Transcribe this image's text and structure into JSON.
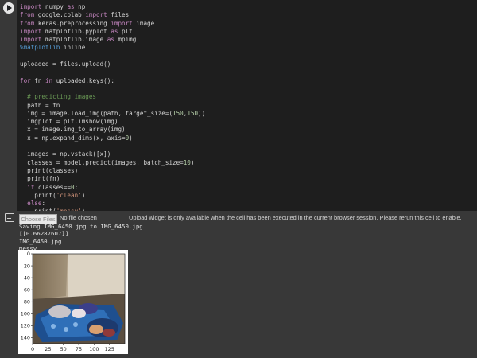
{
  "code": {
    "lines": [
      "import numpy as np",
      "from google.colab import files",
      "from keras.preprocessing import image",
      "import matplotlib.pyplot as plt",
      "import matplotlib.image as mpimg",
      "%matplotlib inline",
      "",
      "uploaded = files.upload()",
      "",
      "for fn in uploaded.keys():",
      "",
      "  # predicting images",
      "  path = fn",
      "  img = image.load_img(path, target_size=(150,150))",
      "  imgplot = plt.imshow(img)",
      "  x = image.img_to_array(img)",
      "  x = np.expand_dims(x, axis=0)",
      "",
      "  images = np.vstack([x])",
      "  classes = model.predict(images, batch_size=10)",
      "  print(classes)",
      "  print(fn)",
      "  if classes==0:",
      "    print('clean')",
      "  else:",
      "    print('messy')"
    ]
  },
  "upload_widget": {
    "button_label": "Choose Files",
    "file_status": "No file chosen",
    "note": "Upload widget is only available when the cell has been executed in the current browser session. Please rerun this cell to enable."
  },
  "output": {
    "lines": [
      "Saving IMG_6450.jpg to IMG_6450.jpg",
      "[[0.66287607]]",
      "IMG_6450.jpg",
      "messy"
    ]
  },
  "plot": {
    "y_ticks": [
      "0",
      "20",
      "40",
      "60",
      "80",
      "100",
      "120",
      "140"
    ],
    "x_ticks": [
      "0",
      "25",
      "50",
      "75",
      "100",
      "125"
    ]
  },
  "colors": {
    "editor_bg": "#1e1e1e",
    "page_bg": "#383838",
    "keyword": "#c586c0",
    "comment": "#6a9955",
    "string": "#ce9178"
  }
}
